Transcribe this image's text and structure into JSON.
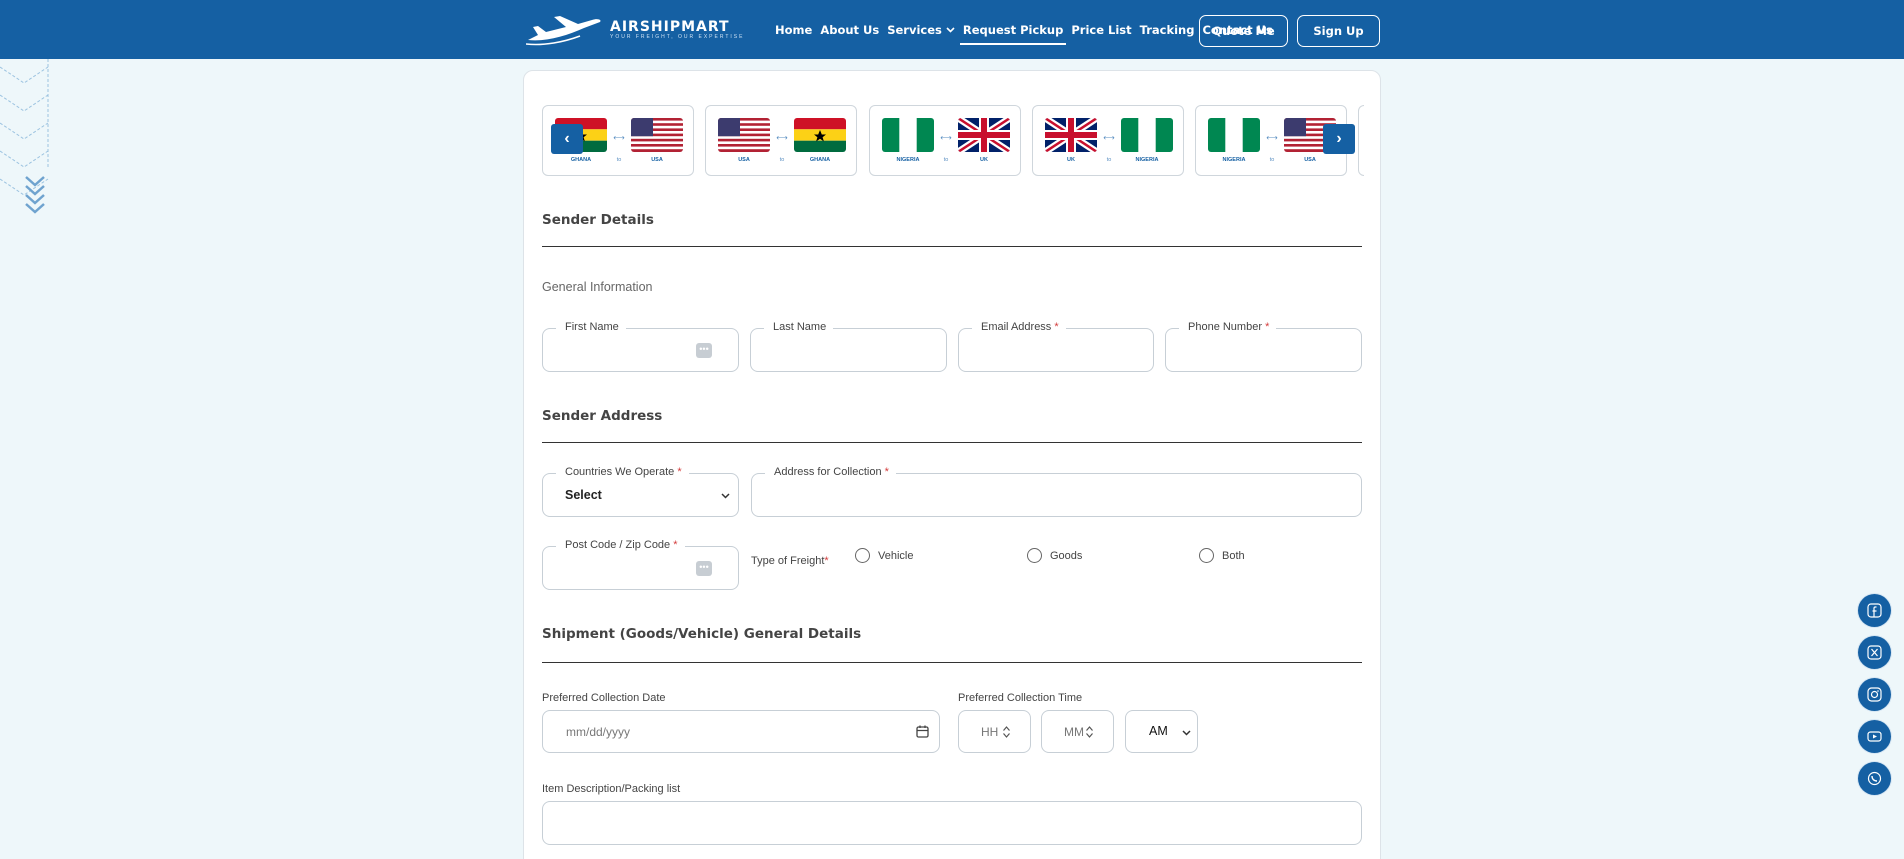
{
  "header": {
    "logo_text": "AIRSHIPMART",
    "logo_tagline": "YOUR FREIGHT, OUR EXPERTISE",
    "nav": [
      {
        "label": "Home"
      },
      {
        "label": "About Us"
      },
      {
        "label": "Services"
      },
      {
        "label": "Request Pickup"
      },
      {
        "label": "Price List"
      },
      {
        "label": "Tracking"
      },
      {
        "label": "Contact Us"
      }
    ],
    "quote_label": "Quote Me",
    "signup_label": "Sign Up"
  },
  "routes": [
    {
      "from": "GHANA",
      "to": "USA",
      "sep": "to"
    },
    {
      "from": "USA",
      "to": "GHANA",
      "sep": "to"
    },
    {
      "from": "NIGERIA",
      "to": "UK",
      "sep": "to"
    },
    {
      "from": "UK",
      "to": "NIGERIA",
      "sep": "to"
    },
    {
      "from": "NIGERIA",
      "to": "USA",
      "sep": "to"
    }
  ],
  "carousel": {
    "prev": "‹",
    "next": "›"
  },
  "sender_details": {
    "title": "Sender Details",
    "general_info": "General Information",
    "first_name": "First Name",
    "last_name": "Last Name",
    "email": "Email Address",
    "phone": "Phone Number",
    "required_mark": "*"
  },
  "sender_address": {
    "title": "Sender Address",
    "countries_label": "Countries We Operate",
    "countries_value": "Select",
    "address_label": "Address for Collection",
    "postcode_label": "Post Code / Zip Code",
    "freight_label": "Type of Freight",
    "freight_options": [
      "Vehicle",
      "Goods",
      "Both"
    ]
  },
  "shipment": {
    "title": "Shipment (Goods/Vehicle) General Details",
    "date_label": "Preferred Collection Date",
    "date_placeholder": "mm/dd/yyyy",
    "time_label": "Preferred Collection Time",
    "hour_placeholder": "HH",
    "minute_placeholder": "MM",
    "ampm_value": "AM",
    "item_desc_label": "Item Description/Packing list"
  },
  "social": [
    "facebook-icon",
    "x-icon",
    "instagram-icon",
    "youtube-icon",
    "whatsapp-icon"
  ],
  "colors": {
    "brand": "#1560a3",
    "background": "#eef7fa",
    "required": "#d43c3c"
  }
}
